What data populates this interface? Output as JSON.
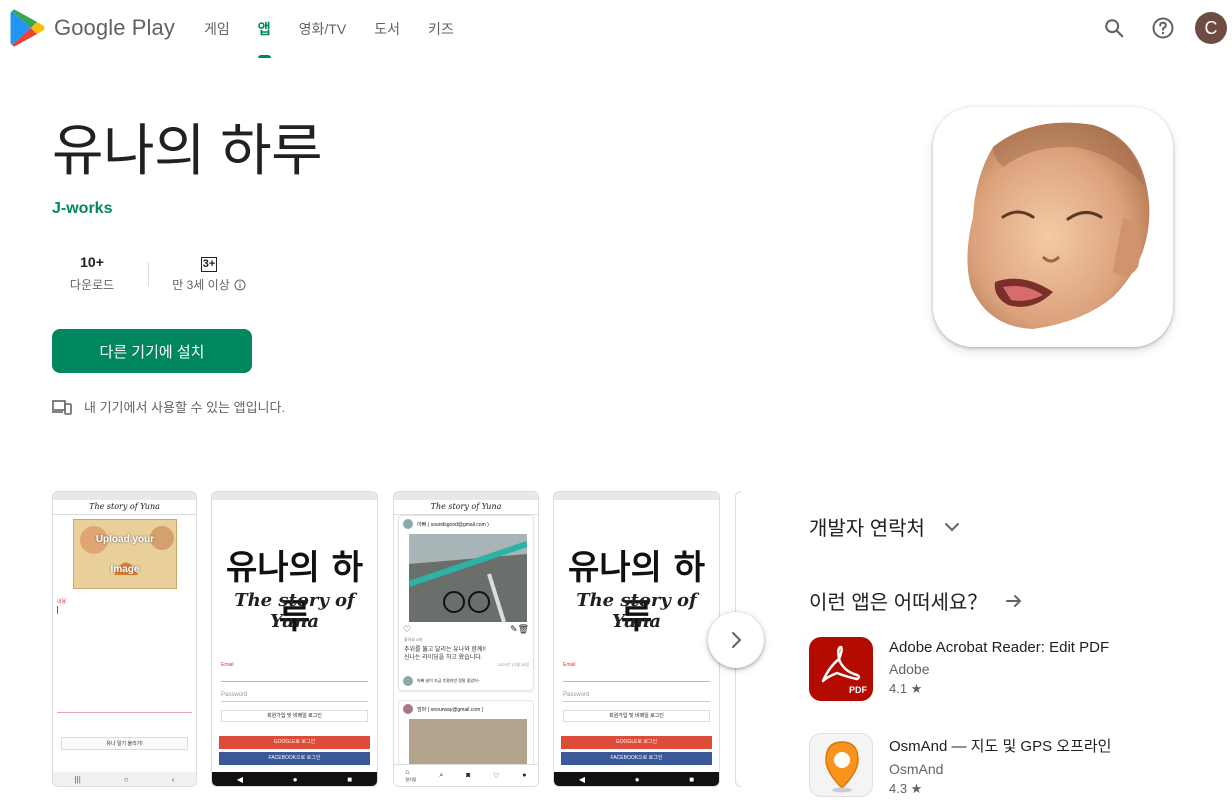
{
  "header": {
    "brand": "Google Play",
    "nav": [
      {
        "label": "게임",
        "active": false
      },
      {
        "label": "앱",
        "active": true
      },
      {
        "label": "영화/TV",
        "active": false
      },
      {
        "label": "도서",
        "active": false
      },
      {
        "label": "키즈",
        "active": false
      }
    ],
    "icons": [
      "search-icon",
      "help-icon"
    ],
    "avatar_letter": "C",
    "accent": "#01875f"
  },
  "app": {
    "title": "유나의 하루",
    "developer": "J-works",
    "downloads_value": "10+",
    "downloads_label": "다운로드",
    "content_rating": "3+",
    "content_rating_label": "만 3세 이상",
    "install_label": "다른 기기에 설치",
    "availability_note": "내 기기에서 사용할 수 있는 앱입니다."
  },
  "screenshots": {
    "s1": {
      "header_title": "The story of Yuna",
      "upload_line1": "Upload your",
      "upload_line2": "Image",
      "field_label": "내용",
      "button": "유나 일기 올리기!"
    },
    "s2": {
      "title_ko": "유나의 하루",
      "title_en": "The story of Yuna",
      "email_label": "Email",
      "password_label": "Password",
      "signup": "회원가입 및 비메일 로그인",
      "google": "GOOGLE로 로그인",
      "facebook": "FACEBOOK으로 로그인"
    },
    "s3": {
      "header_title": "The story of Yuna",
      "post_user": "아빠 ( soundsgood@gmail.com )",
      "likes": "좋아요 0개",
      "caption1": "추위를 뚫고 달리는 유나와 함께!!",
      "caption2": "신나는 라이딩을 하고 왔습니다.",
      "date": "2020년 12월 28일",
      "comment": "아빠   날이 조금 추웠지만 정말 좋았어~",
      "post2_user": "엄마 ( onourway@gmail.com )",
      "tab_label": "알기장"
    },
    "s4": {
      "title_ko": "유나의 하루",
      "title_en": "The story of Yuna",
      "email_label": "Email",
      "password_label": "Password",
      "signup": "회원가입 및 비메일 로그인",
      "google": "GOOGLE로 로그인",
      "facebook": "FACEBOOK으로 로그인"
    }
  },
  "sidebar": {
    "dev_contact": "개발자 연락처",
    "similar_heading": "이런 앱은 어떠세요？",
    "similar_apps": [
      {
        "title": "Adobe Acrobat Reader: Edit PDF",
        "developer": "Adobe",
        "rating": "4.1 ★",
        "icon": "adobe-pdf-icon"
      },
      {
        "title": "OsmAnd — 지도 및 GPS 오프라인",
        "developer": "OsmAnd",
        "rating": "4.3 ★",
        "icon": "osmand-map-pin-icon"
      }
    ]
  }
}
